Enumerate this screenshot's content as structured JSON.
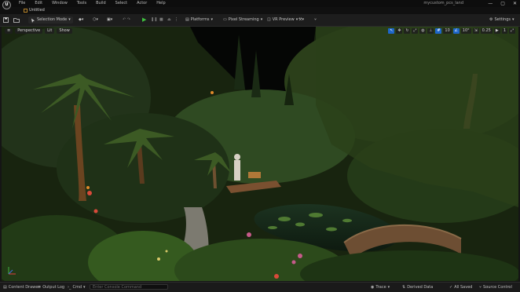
{
  "app": {
    "logo_text": "U"
  },
  "menu": [
    "File",
    "Edit",
    "Window",
    "Tools",
    "Build",
    "Select",
    "Actor",
    "Help"
  ],
  "project_name": "mycustom_pcs_land",
  "window_controls": [
    "—",
    "▢",
    "✕"
  ],
  "level_tab": {
    "label": "Untitled"
  },
  "toolbar": {
    "mode": "Selection Mode",
    "platforms": "Platforms",
    "pixel_streaming": "Pixel Streaming",
    "vr_preview": "VR Preview",
    "settings": "Settings"
  },
  "viewport": {
    "perspective": "Perspective",
    "lit": "Lit",
    "show": "Show",
    "grid_value": "10",
    "angle_value": "10°",
    "scale_value": "0.25",
    "camera_speed": "1"
  },
  "statusbar": {
    "content_drawer": "Content Drawer",
    "output_log": "Output Log",
    "cmd": "Cmd",
    "console_placeholder": "Enter Console Command",
    "trace": "Trace",
    "derived_data": "Derived Data",
    "all_saved": "All Saved",
    "source_control": "Source Control"
  },
  "colors": {
    "accent": "#1e66c8",
    "play": "#3fbf3f"
  }
}
